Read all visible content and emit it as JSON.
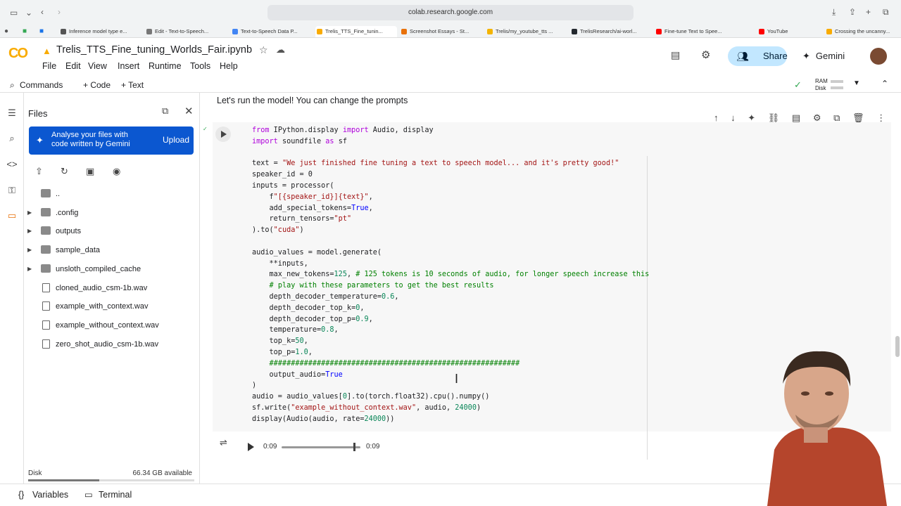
{
  "browser": {
    "url": "colab.research.google.com",
    "tabs": [
      {
        "label": "Inference model type e...",
        "color": "#555555"
      },
      {
        "label": "Edit - Text-to-Speech...",
        "color": "#777777"
      },
      {
        "label": "Text-to-Speech Data P...",
        "color": "#4285f4"
      },
      {
        "label": "Trelis_TTS_Fine_tunin...",
        "color": "#f9ab00"
      },
      {
        "label": "Screenshot Essays - St...",
        "color": "#e8710a"
      },
      {
        "label": "Trelis/my_youtube_tts ...",
        "color": "#f4b400"
      },
      {
        "label": "TrelisResearch/ai-worl...",
        "color": "#24292f"
      },
      {
        "label": "Fine-tune Text to Spee...",
        "color": "#ff0000"
      },
      {
        "label": "YouTube",
        "color": "#ff0000"
      },
      {
        "label": "Crossing the uncanny...",
        "color": "#f9ab00"
      }
    ]
  },
  "header": {
    "logo_text": "CO",
    "title": "Trelis_TTS_Fine_tuning_Worlds_Fair.ipynb",
    "menu": [
      "File",
      "Edit",
      "View",
      "Insert",
      "Runtime",
      "Tools",
      "Help"
    ],
    "share_label": "Share",
    "gemini_label": "Gemini"
  },
  "toolbar": {
    "commands_label": "Commands",
    "code_label": "+ Code",
    "text_label": "+ Text",
    "ram_label": "RAM",
    "disk_label": "Disk"
  },
  "files_panel": {
    "title": "Files",
    "banner_text": "Analyse your files with code written by Gemini",
    "upload_label": "Upload",
    "items": [
      {
        "name": "..",
        "type": "folder",
        "expandable": false
      },
      {
        "name": ".config",
        "type": "folder",
        "expandable": true
      },
      {
        "name": "outputs",
        "type": "folder",
        "expandable": true
      },
      {
        "name": "sample_data",
        "type": "folder",
        "expandable": true
      },
      {
        "name": "unsloth_compiled_cache",
        "type": "folder",
        "expandable": true
      },
      {
        "name": "cloned_audio_csm-1b.wav",
        "type": "file",
        "expandable": false
      },
      {
        "name": "example_with_context.wav",
        "type": "file",
        "expandable": false
      },
      {
        "name": "example_without_context.wav",
        "type": "file",
        "expandable": false
      },
      {
        "name": "zero_shot_audio_csm-1b.wav",
        "type": "file",
        "expandable": false
      }
    ],
    "disk_label": "Disk",
    "disk_available": "66.34 GB available",
    "disk_used_fraction": 0.43
  },
  "notebook": {
    "text_cell": "Let's run the model! You can change the prompts",
    "code_lines": [
      "from IPython.display import Audio, display",
      "import soundfile as sf",
      "",
      "text = \"We just finished fine tuning a text to speech model... and it's pretty good!\"",
      "speaker_id = 0",
      "inputs = processor(",
      "    f\"[{speaker_id}]{text}\",",
      "    add_special_tokens=True,",
      "    return_tensors=\"pt\"",
      ").to(\"cuda\")",
      "",
      "audio_values = model.generate(",
      "    **inputs,",
      "    max_new_tokens=125, # 125 tokens is 10 seconds of audio, for longer speech increase this",
      "    # play with these parameters to get the best results",
      "    depth_decoder_temperature=0.6,",
      "    depth_decoder_top_k=0,",
      "    depth_decoder_top_p=0.9,",
      "    temperature=0.8,",
      "    top_k=50,",
      "    top_p=1.0,",
      "    ##########################################################",
      "    output_audio=True",
      ")",
      "audio = audio_values[0].to(torch.float32).cpu().numpy()",
      "sf.write(\"example_without_context.wav\", audio, 24000)",
      "display(Audio(audio, rate=24000))"
    ],
    "audio": {
      "current_time": "0:09",
      "duration": "0:09",
      "progress": 1.0
    }
  },
  "bottom_bar": {
    "variables_label": "Variables",
    "terminal_label": "Terminal"
  }
}
